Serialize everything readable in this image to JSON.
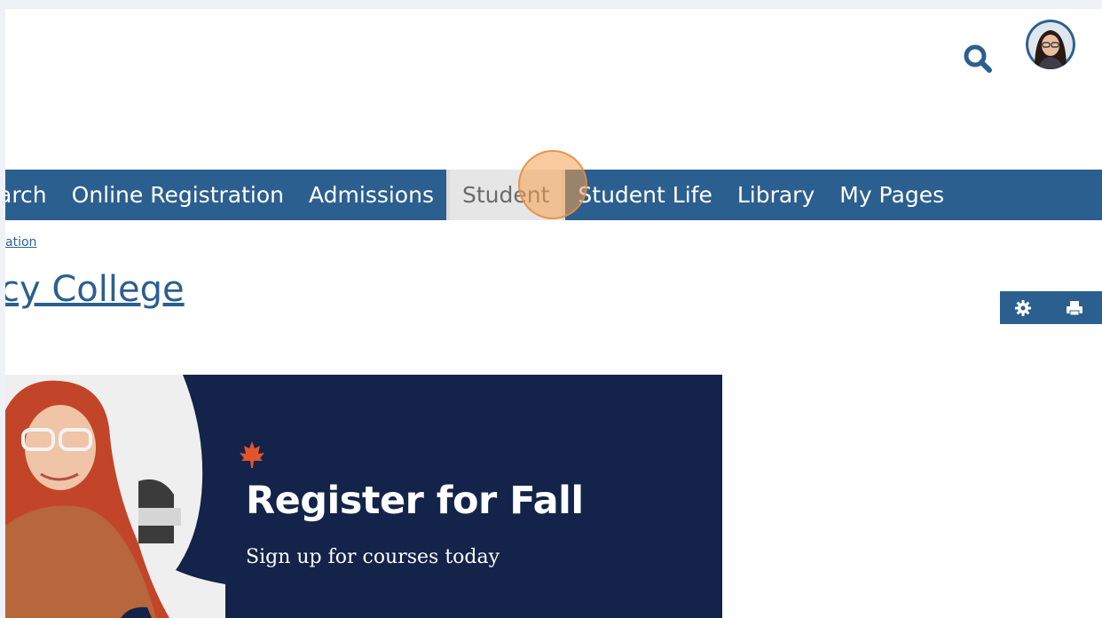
{
  "header": {
    "search_icon": "search-icon",
    "avatar": "user-avatar"
  },
  "nav": {
    "items": [
      {
        "label": "arch"
      },
      {
        "label": "Online Registration"
      },
      {
        "label": "Admissions"
      },
      {
        "label": "Student"
      },
      {
        "label": "Student Life"
      },
      {
        "label": "Library"
      },
      {
        "label": "My Pages"
      }
    ],
    "active": "Student"
  },
  "breadcrumb": "ation",
  "page_title": "cy College",
  "tools": {
    "settings_icon": "gear-icon",
    "print_icon": "print-icon"
  },
  "banner": {
    "heading": "Register for Fall",
    "subheading": "Sign up for courses today"
  },
  "colors": {
    "brand": "#2b5f8f",
    "banner_bg": "#13234a",
    "accent": "#e2542c",
    "active_tab_bg": "#e6e6e6"
  }
}
